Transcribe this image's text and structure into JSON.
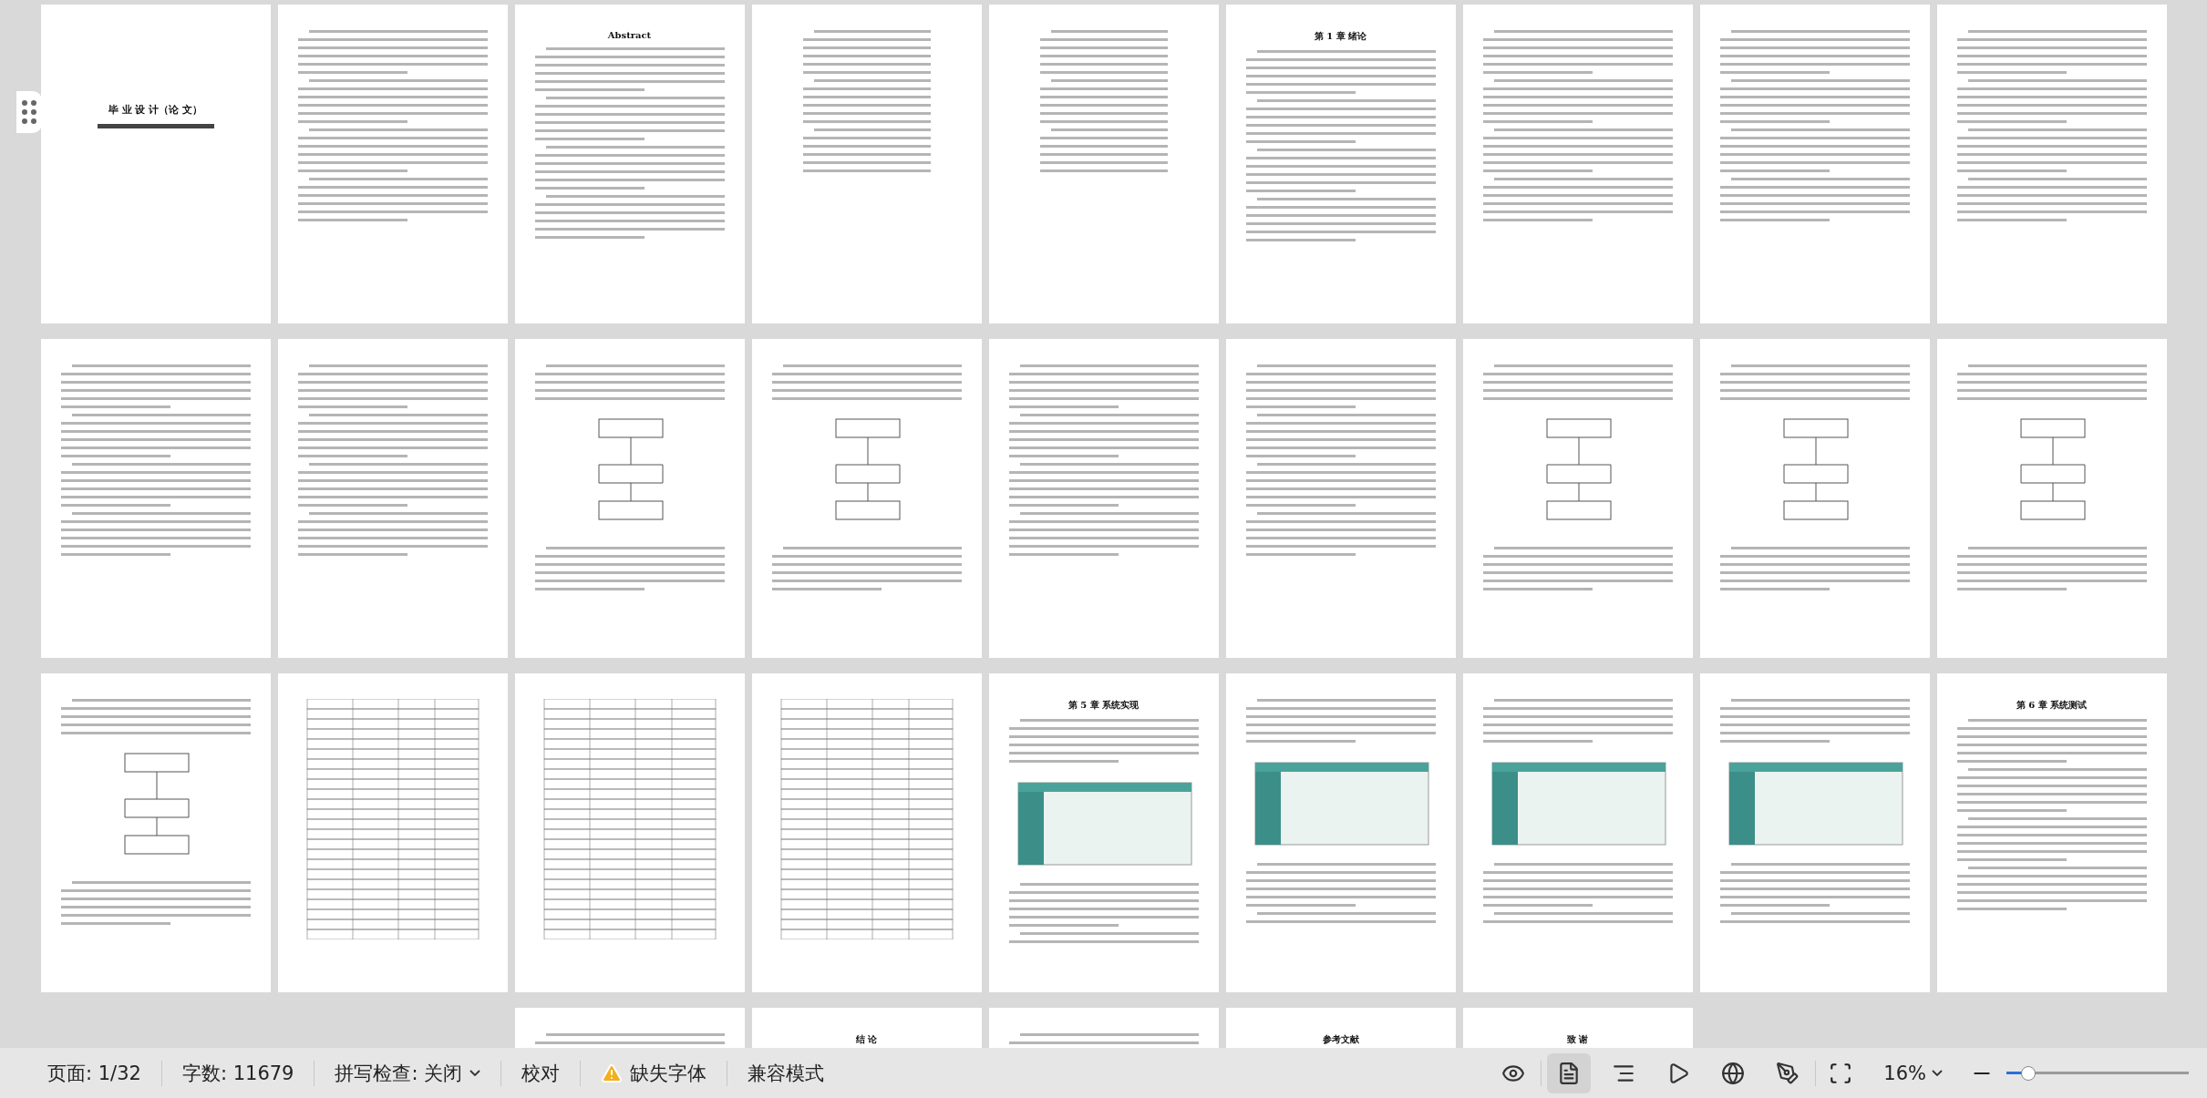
{
  "pages": [
    {
      "kind": "cover",
      "heading": "毕 业 设 计（论 文）"
    },
    {
      "kind": "text"
    },
    {
      "kind": "text",
      "heading": "Abstract"
    },
    {
      "kind": "toc"
    },
    {
      "kind": "toc"
    },
    {
      "kind": "text",
      "heading": "第 1 章 绪论"
    },
    {
      "kind": "text"
    },
    {
      "kind": "text"
    },
    {
      "kind": "text"
    },
    {
      "kind": "text"
    },
    {
      "kind": "text"
    },
    {
      "kind": "figure"
    },
    {
      "kind": "figure"
    },
    {
      "kind": "text"
    },
    {
      "kind": "text"
    },
    {
      "kind": "figure"
    },
    {
      "kind": "figure"
    },
    {
      "kind": "figure"
    },
    {
      "kind": "figure"
    },
    {
      "kind": "table"
    },
    {
      "kind": "table"
    },
    {
      "kind": "table"
    },
    {
      "kind": "screenshot",
      "heading": "第 5 章 系统实现"
    },
    {
      "kind": "screenshot"
    },
    {
      "kind": "screenshot"
    },
    {
      "kind": "screenshot"
    },
    {
      "kind": "text",
      "heading": "第 6 章 系统测试"
    },
    {
      "kind": "text"
    },
    {
      "kind": "text",
      "heading": "结 论"
    },
    {
      "kind": "text"
    },
    {
      "kind": "text",
      "heading": "参考文献"
    },
    {
      "kind": "text",
      "heading": "致 谢"
    }
  ],
  "status_bar": {
    "page": "页面: 1/32",
    "word_count": "字数: 11679",
    "spell_check": "拼写检查: 关闭",
    "proofread": "校对",
    "missing_fonts": "缺失字体",
    "compat_mode": "兼容模式",
    "views": [
      {
        "kind": "reading",
        "selected": false
      },
      {
        "kind": "page",
        "selected": true
      },
      {
        "kind": "outline",
        "selected": false
      },
      {
        "kind": "play",
        "selected": false
      },
      {
        "kind": "web",
        "selected": false
      },
      {
        "kind": "pen",
        "selected": false
      }
    ],
    "zoom": "16%",
    "zoom_level": {
      "level": 0.12
    }
  }
}
